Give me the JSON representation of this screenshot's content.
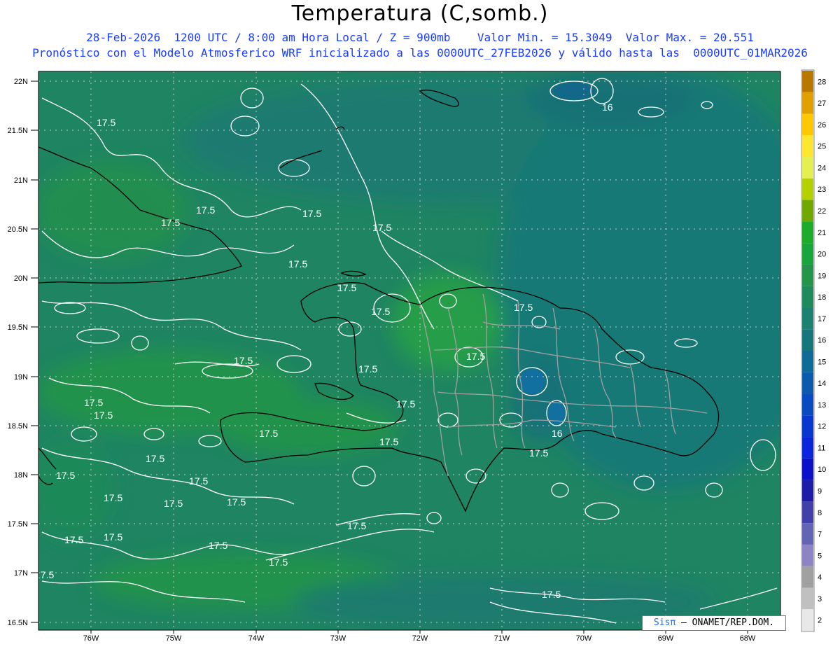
{
  "title": "Temperatura (C,somb.)",
  "subtitle_line1": "28-Feb-2026  1200 UTC / 8:00 am Hora Local / Z = 900mb    Valor Min. = 15.3049  Valor Max. = 20.551",
  "subtitle_line2": "Pronóstico con el Modelo Atmosferico WRF inicializado a las 0000UTC_27FEB2026 y válido hasta las  0000UTC_01MAR2026",
  "credit": {
    "brand": "Sisπ",
    "text": "– ONAMET/REP.DOM."
  },
  "lat_labels": [
    "22N",
    "21.5N",
    "21N",
    "20.5N",
    "20N",
    "19.5N",
    "19N",
    "18.5N",
    "18N",
    "17.5N",
    "17N",
    "16.5N"
  ],
  "lon_labels": [
    "76W",
    "75W",
    "74W",
    "73W",
    "72W",
    "71W",
    "70W",
    "69W",
    "68W"
  ],
  "contour_labels": [
    "17.5",
    "17.5",
    "17.5",
    "17.5",
    "17.5",
    "17.5",
    "17.5",
    "17.5",
    "17.5",
    "17.5",
    "17.5",
    "17.5",
    "17.5",
    "17.5",
    "17.5",
    "17.5",
    "17.5",
    "17.5",
    "17.5",
    "17.5",
    "17.5",
    "17.5",
    "17.5",
    "17.5",
    "17.5",
    "17.5",
    "16",
    "16"
  ],
  "colorbar": {
    "labels": [
      "28",
      "27",
      "26",
      "25",
      "24",
      "23",
      "22",
      "21",
      "20",
      "19",
      "18",
      "17",
      "16",
      "15",
      "14",
      "13",
      "12",
      "11",
      "10",
      "9",
      "8",
      "7",
      "5",
      "4",
      "3",
      "2"
    ],
    "colors": [
      "#b87800",
      "#e0a000",
      "#ffc800",
      "#ffe630",
      "#e4f050",
      "#b4d000",
      "#70a800",
      "#1cac2c",
      "#1aa43c",
      "#23944a",
      "#1f8a5e",
      "#1c8170",
      "#15777c",
      "#0e6a96",
      "#0c5aac",
      "#0a4ac0",
      "#0a36d0",
      "#0a24dc",
      "#0a10c8",
      "#1c1ca8",
      "#4040a8",
      "#6464b4",
      "#8c84c4",
      "#a0a0a0",
      "#c0c0c0",
      "#e8e8e8"
    ]
  },
  "colors": {
    "background_field": "#1f8462",
    "subtitle": "#1a3cff",
    "contour": "#ffffff",
    "coast": "#000000",
    "provinces": "#a0a0a0"
  }
}
